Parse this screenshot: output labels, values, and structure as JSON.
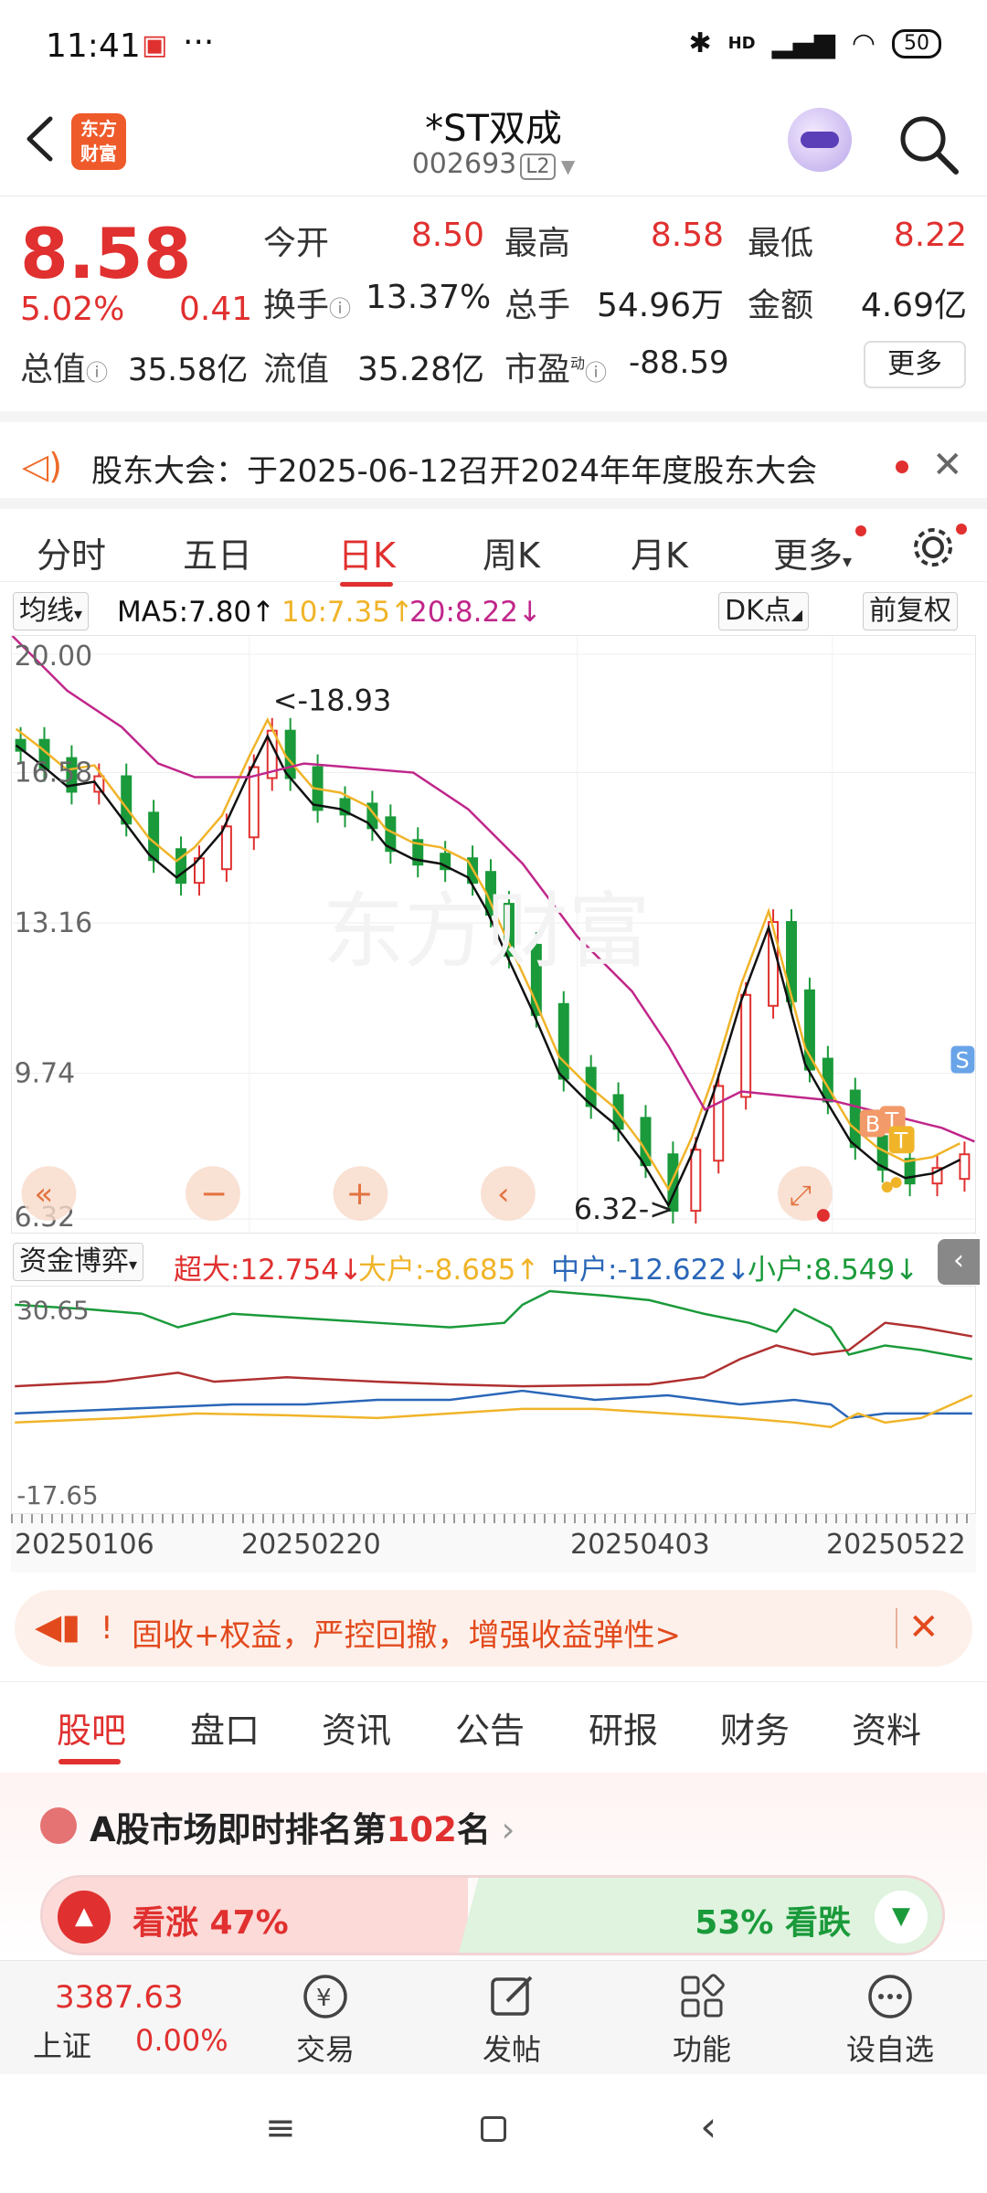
{
  "status_bar": {
    "time": "11:41",
    "battery": "50",
    "network": "HD"
  },
  "header": {
    "logo_line1": "东方",
    "logo_line2": "财富",
    "stock_name": "*ST双成",
    "stock_code": "002693",
    "level": "L2"
  },
  "quote": {
    "price": "8.58",
    "change_pct": "5.02%",
    "change": "0.41",
    "open_label": "今开",
    "open": "8.50",
    "high_label": "最高",
    "high": "8.58",
    "low_label": "最低",
    "low": "8.22",
    "turnover_label": "换手",
    "turnover": "13.37%",
    "volume_label": "总手",
    "volume": "54.96万",
    "amount_label": "金额",
    "amount": "4.69亿",
    "mcap_label": "总值",
    "mcap": "35.58亿",
    "float_label": "流值",
    "float_mcap": "35.28亿",
    "pe_label": "市盈",
    "pe_sup": "动",
    "pe": "-88.59",
    "more": "更多"
  },
  "notice": {
    "text": "股东大会：于2025-06-12召开2024年年度股东大会"
  },
  "period_tabs": [
    "分时",
    "五日",
    "日K",
    "周K",
    "月K",
    "更多"
  ],
  "active_period": "日K",
  "ma_bar": {
    "selector": "均线",
    "ma5": "MA5:7.80↑",
    "ma10": "10:7.35↑",
    "ma20": "20:8.22↓",
    "dk": "DK点",
    "adjust": "前复权"
  },
  "colors": {
    "red": "#e0302f",
    "green": "#1a9a3a",
    "ma5": "#111111",
    "ma10": "#f0b429",
    "ma20": "#c0268a",
    "blue": "#2a66b8"
  },
  "kline": {
    "y_labels": [
      "20.00",
      "16.58",
      "13.16",
      "9.74",
      "6.32"
    ],
    "high_annotation": "<-18.93",
    "low_annotation": "6.32->",
    "watermark": "东方财富",
    "markers": [
      "B",
      "T",
      "T",
      "S"
    ]
  },
  "flow_bar": {
    "selector": "资金博弈",
    "super": "超大:12.754↓",
    "large": "大户:-8.685↑",
    "mid": "中户:-12.622↓",
    "small": "小户:8.549↓"
  },
  "flow": {
    "top_label": "30.65",
    "bottom_label": "-17.65"
  },
  "dates": [
    "20250106",
    "20250220",
    "20250403",
    "20250522"
  ],
  "ad": {
    "text": "固收+权益，严控回撤，增强收益弹性>"
  },
  "content_tabs": [
    "股吧",
    "盘口",
    "资讯",
    "公告",
    "研报",
    "财务",
    "资料"
  ],
  "active_content": "股吧",
  "rank": {
    "prefix": "A股市场即时排名第",
    "number": "102",
    "suffix": "名"
  },
  "vote": {
    "up": "看涨 47%",
    "down": "53% 看跌"
  },
  "index": {
    "value": "3387.63",
    "name": "上证",
    "change": "0.00%"
  },
  "tools": [
    "交易",
    "发帖",
    "功能",
    "设自选"
  ]
}
